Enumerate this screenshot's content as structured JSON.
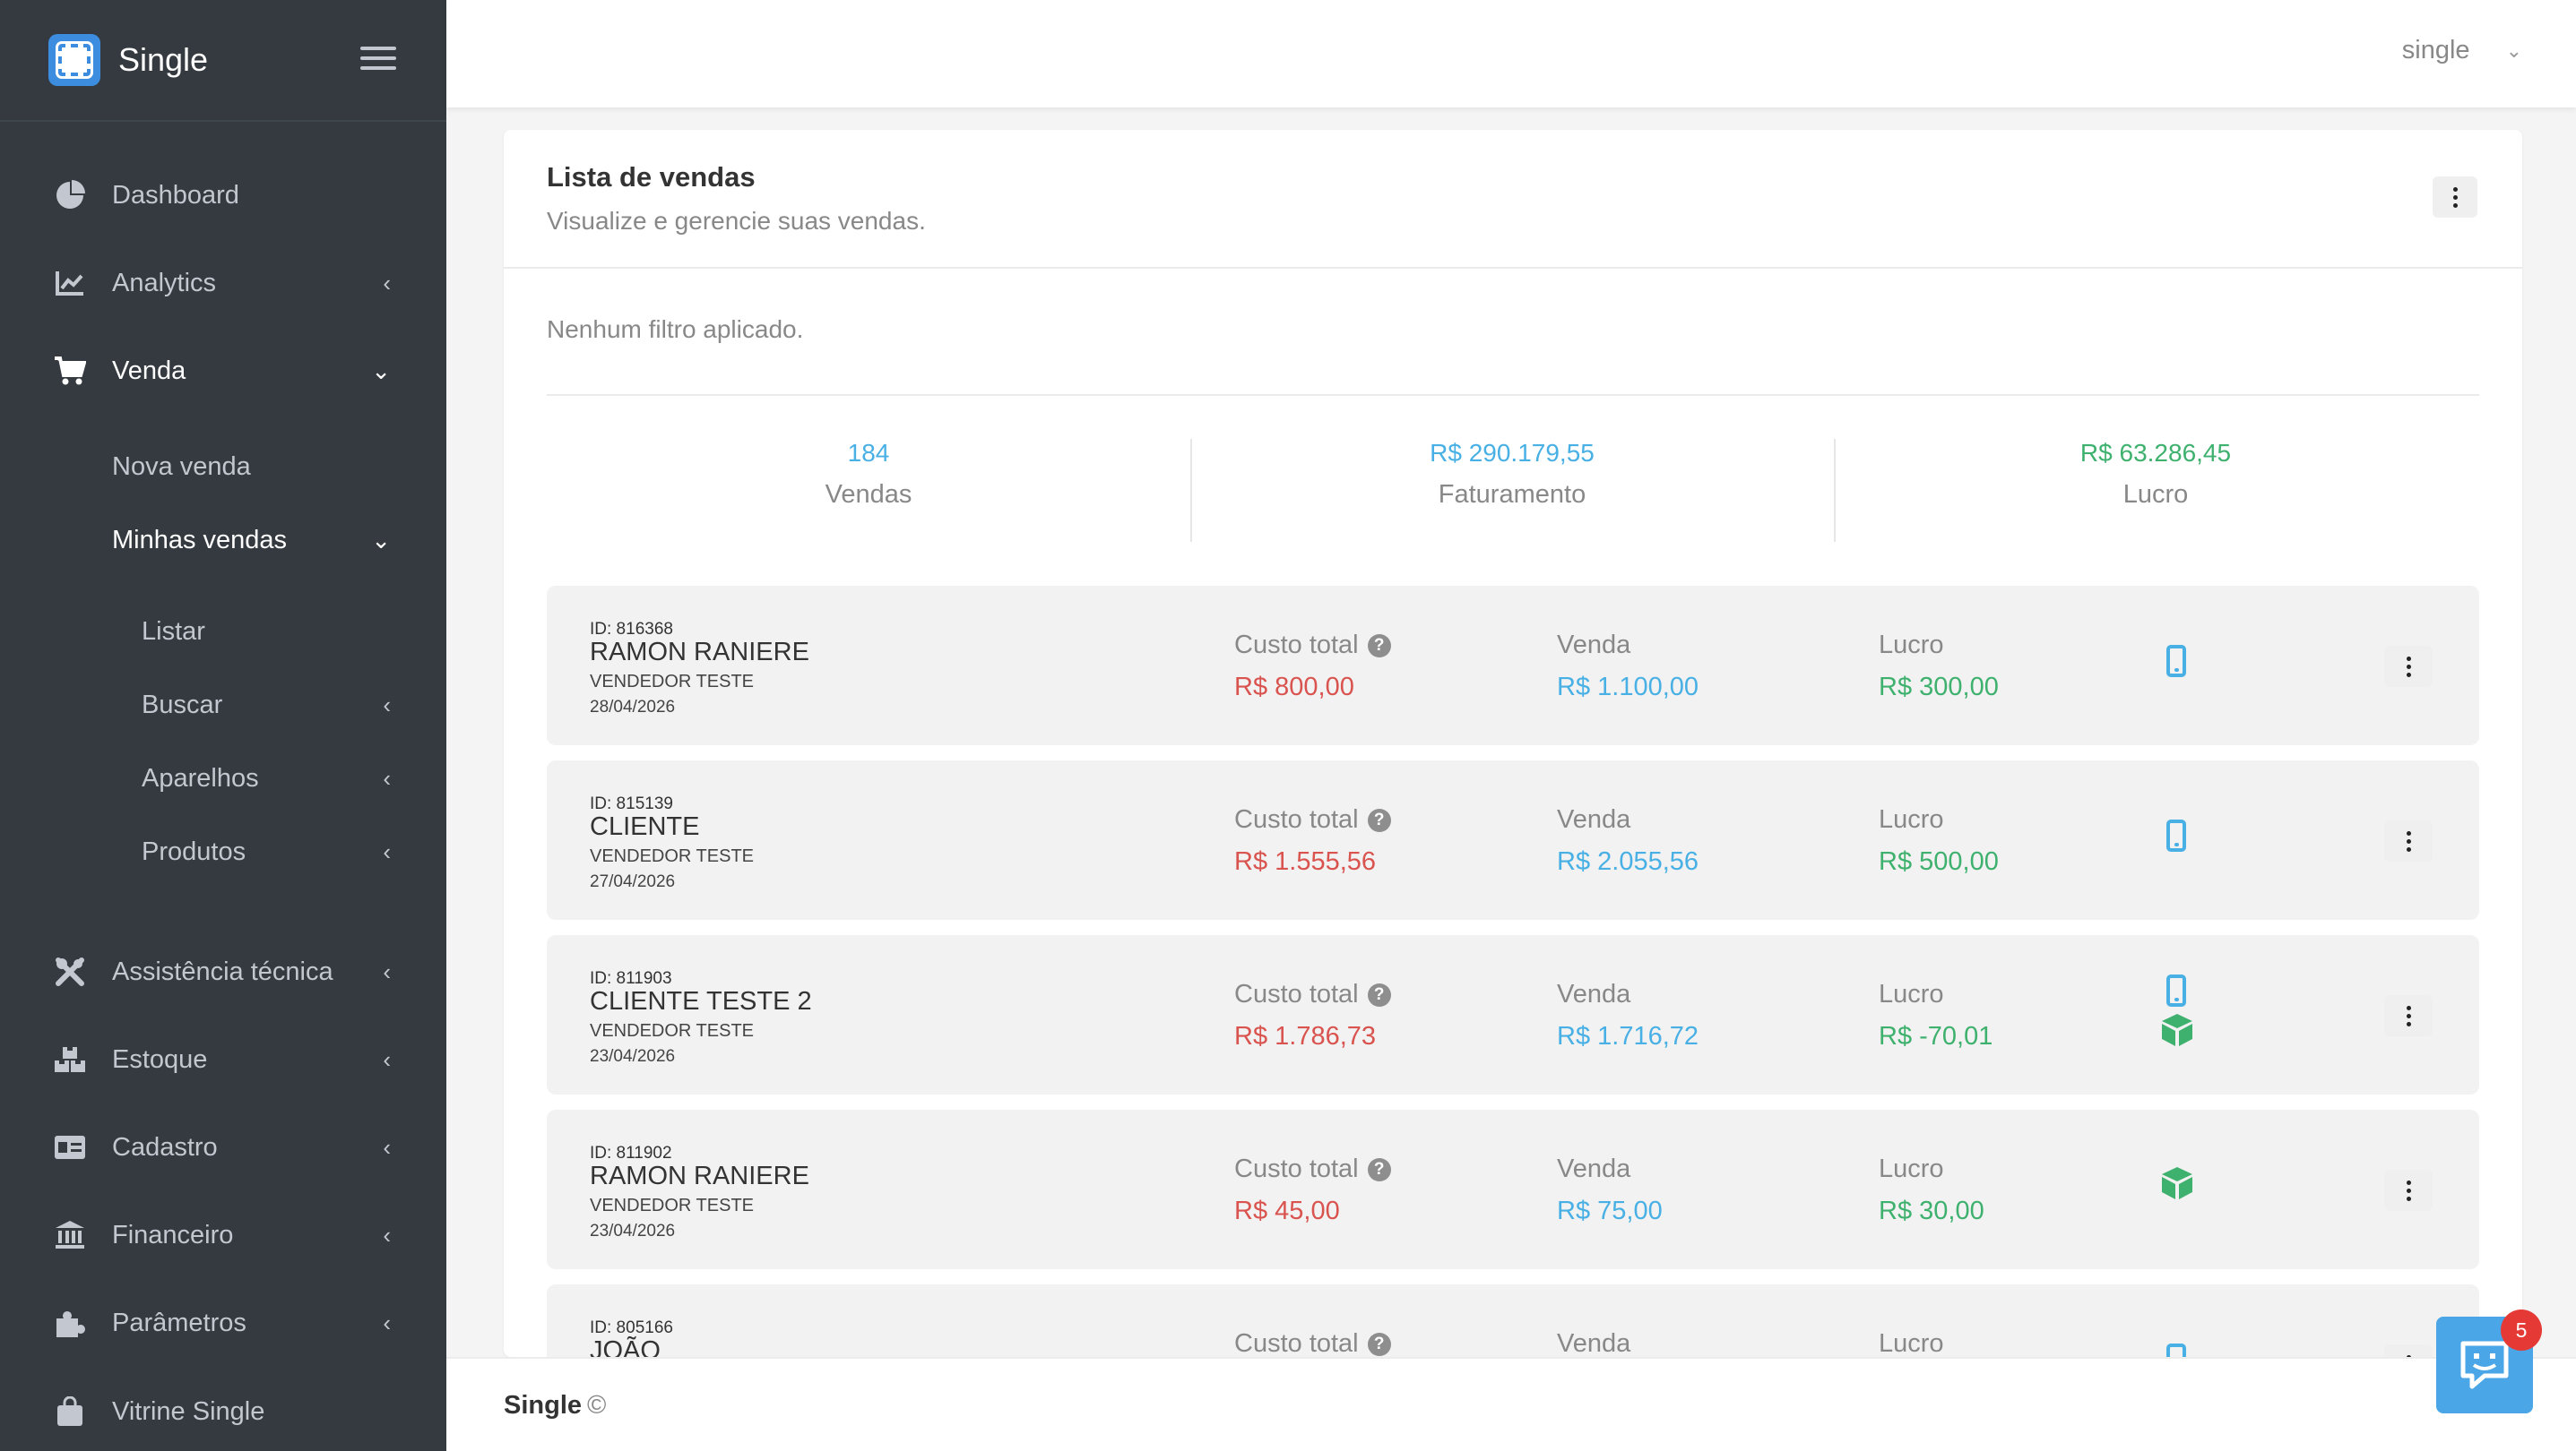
{
  "app": {
    "name": "Single"
  },
  "sidebar": {
    "items": [
      {
        "label": "Dashboard",
        "icon": "pie-chart-icon"
      },
      {
        "label": "Analytics",
        "icon": "line-chart-icon"
      },
      {
        "label": "Venda",
        "icon": "cart-icon"
      },
      {
        "label": "Nova venda"
      },
      {
        "label": "Minhas vendas"
      },
      {
        "label": "Listar"
      },
      {
        "label": "Buscar"
      },
      {
        "label": "Aparelhos"
      },
      {
        "label": "Produtos"
      },
      {
        "label": "Assistência técnica",
        "icon": "tools-icon"
      },
      {
        "label": "Estoque",
        "icon": "boxes-icon"
      },
      {
        "label": "Cadastro",
        "icon": "id-card-icon"
      },
      {
        "label": "Financeiro",
        "icon": "bank-icon"
      },
      {
        "label": "Parâmetros",
        "icon": "puzzle-icon"
      },
      {
        "label": "Vitrine Single",
        "icon": "shopping-bag-icon"
      }
    ]
  },
  "topbar": {
    "user": "single"
  },
  "card": {
    "title": "Lista de vendas",
    "subtitle": "Visualize e gerencie suas vendas.",
    "filter": "Nenhum filtro aplicado."
  },
  "stats": [
    {
      "value": "184",
      "label": "Vendas",
      "color": "#48b0e4"
    },
    {
      "value": "R$ 290.179,55",
      "label": "Faturamento",
      "color": "#48b0e4"
    },
    {
      "value": "R$ 63.286,45",
      "label": "Lucro",
      "color": "#3fb16e"
    }
  ],
  "columns": {
    "cost": "Custo total",
    "sale": "Venda",
    "profit": "Lucro"
  },
  "sales": [
    {
      "id": "ID: 816368",
      "name": "RAMON RANIERE",
      "seller": "VENDEDOR TESTE",
      "date": "28/04/2026",
      "cost": "R$ 800,00",
      "sale": "R$ 1.100,00",
      "profit": "R$ 300,00",
      "icons": [
        "phone-icon"
      ]
    },
    {
      "id": "ID: 815139",
      "name": "CLIENTE",
      "seller": "VENDEDOR TESTE",
      "date": "27/04/2026",
      "cost": "R$ 1.555,56",
      "sale": "R$ 2.055,56",
      "profit": "R$ 500,00",
      "icons": [
        "phone-icon"
      ]
    },
    {
      "id": "ID: 811903",
      "name": "CLIENTE TESTE 2",
      "seller": "VENDEDOR TESTE",
      "date": "23/04/2026",
      "cost": "R$ 1.786,73",
      "sale": "R$ 1.716,72",
      "profit": "R$ -70,01",
      "icons": [
        "phone-icon",
        "box-icon"
      ]
    },
    {
      "id": "ID: 811902",
      "name": "RAMON RANIERE",
      "seller": "VENDEDOR TESTE",
      "date": "23/04/2026",
      "cost": "R$ 45,00",
      "sale": "R$ 75,00",
      "profit": "R$ 30,00",
      "icons": [
        "box-icon"
      ]
    },
    {
      "id": "ID: 805166",
      "name": "JOÃO",
      "seller": "",
      "date": "",
      "cost": "",
      "sale": "",
      "profit": "",
      "icons": [
        "phone-icon"
      ]
    }
  ],
  "footer": {
    "brand": "Single",
    "copyright": "©"
  },
  "chat": {
    "badge": "5"
  }
}
